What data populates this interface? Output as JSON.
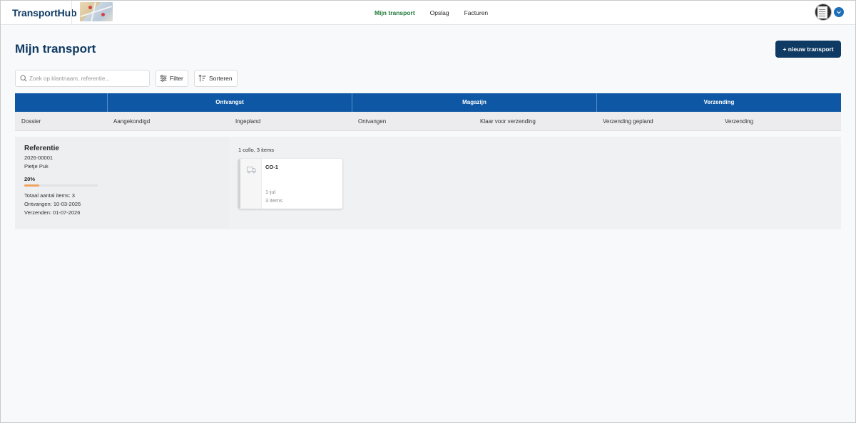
{
  "nav": {
    "logo": "TransportHub",
    "links": [
      "Mijn transport",
      "Opslag",
      "Facturen"
    ],
    "active_index": 0
  },
  "header": {
    "title": "Mijn transport",
    "new_button": "+ nieuw transport"
  },
  "toolbar": {
    "search_placeholder": "Zoek op klantnaam, referentie...",
    "filter_label": "Filter",
    "sort_label": "Sorteren"
  },
  "board": {
    "groups": [
      "Ontvangst",
      "Magazijn",
      "Verzending"
    ],
    "columns": [
      "Dossier",
      "Aangekondigd",
      "Ingepland",
      "Ontvangen",
      "Klaar voor verzending",
      "Verzending gepland",
      "Verzending"
    ]
  },
  "dossier": {
    "title": "Referentie",
    "number": "2026-00001",
    "customer": "Pietje Puk",
    "progress_label": "20%",
    "progress_value": 0.2,
    "total_items": "Totaal aantal items: 3",
    "received": "Ontvangen: 10-03-2026",
    "shipping": "Verzenden: 01-07-2026",
    "colli_summary": "1 collo, 3 items",
    "card": {
      "id": "CO-1",
      "date": "1-jul",
      "items": "3 items"
    }
  },
  "colors": {
    "brand": "#0f3a63",
    "band": "#0d57a4",
    "active_nav": "#1f7a3a",
    "progress": "#f0a35e"
  }
}
